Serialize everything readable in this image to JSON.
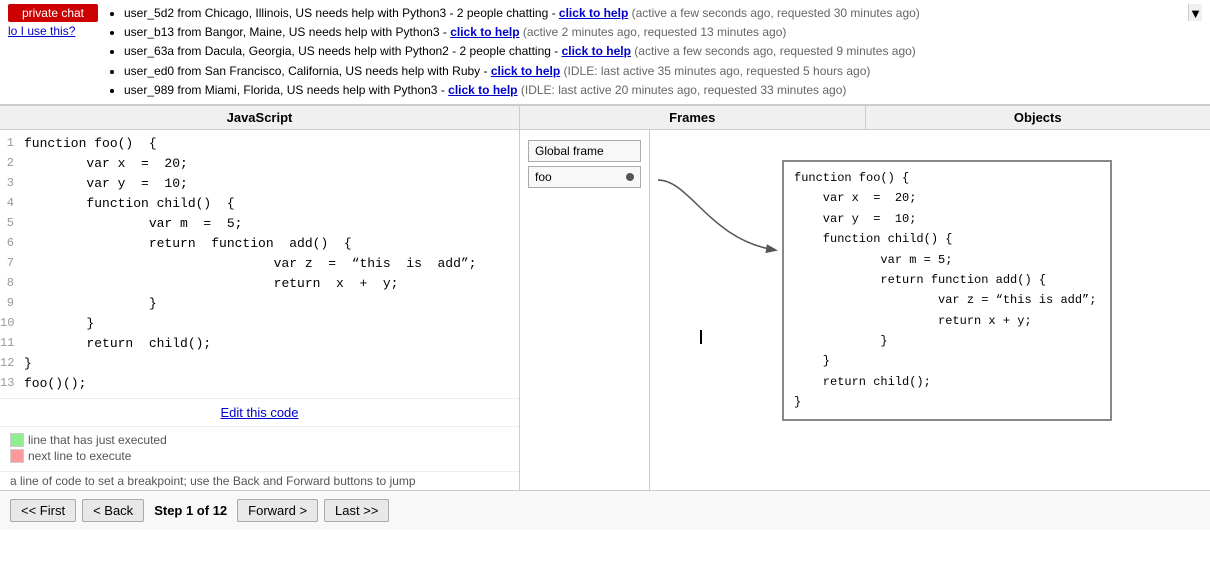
{
  "notifications": {
    "items": [
      {
        "text": "user_5d2 from Chicago, Illinois, US needs help with Python3 - 2 people chatting - ",
        "link": "click to help",
        "meta": "(active a few seconds ago, requested 30 minutes ago)"
      },
      {
        "text": "user_b13 from Bangor, Maine, US needs help with Python3 - ",
        "link": "click to help",
        "meta": "(active 2 minutes ago, requested 13 minutes ago)"
      },
      {
        "text": "user_63a from Dacula, Georgia, US needs help with Python2 - 2 people chatting - ",
        "link": "click to help",
        "meta": "(active a few seconds ago, requested 9 minutes ago)"
      },
      {
        "text": "user_ed0 from San Francisco, California, US needs help with Ruby - ",
        "link": "click to help",
        "meta": "(IDLE: last active 35 minutes ago, requested 5 hours ago)"
      },
      {
        "text": "user_989 from Miami, Florida, US needs help with Python3 - ",
        "link": "click to help",
        "meta": "(IDLE: last active 20 minutes ago, requested 33 minutes ago)"
      }
    ],
    "private_chat_label": "private chat",
    "how_link_label": "lo I use this?"
  },
  "panels": {
    "javascript_label": "JavaScript",
    "frames_label": "Frames",
    "objects_label": "Objects"
  },
  "code": {
    "lines": [
      {
        "num": "1",
        "content": "function foo()  {"
      },
      {
        "num": "2",
        "content": "        var x  =  20;"
      },
      {
        "num": "3",
        "content": "        var y  =  10;"
      },
      {
        "num": "4",
        "content": "        function child()  {"
      },
      {
        "num": "5",
        "content": "                var m  =  5;"
      },
      {
        "num": "6",
        "content": "                return  function  add()  {"
      },
      {
        "num": "7",
        "content": "                                var z  =  “this  is  add”;"
      },
      {
        "num": "8",
        "content": "                                return  x  +  y;"
      },
      {
        "num": "9",
        "content": "                }"
      },
      {
        "num": "10",
        "content": "        }"
      },
      {
        "num": "11",
        "content": "        return  child();"
      },
      {
        "num": "12",
        "content": "}"
      },
      {
        "num": "13",
        "content": "foo()();"
      }
    ],
    "edit_link": "Edit this code"
  },
  "legend": {
    "green_label": "line that has just executed",
    "red_label": "next line to execute",
    "click_hint": "a line of code to set a breakpoint; use the Back and Forward buttons to jump"
  },
  "frames": {
    "global_label": "Global frame",
    "foo_label": "foo"
  },
  "objects": {
    "display_text": "function foo() {\n    var x  =  20;\n    var y  =  10;\n    function child() {\n            var m = 5;\n            return function add() {\n                    var z = “this is add”;\n                    return x + y;\n            }\n    }\n    return child();\n}"
  },
  "navigation": {
    "first_label": "<< First",
    "back_label": "< Back",
    "step_text": "Step 1 of 12",
    "forward_label": "Forward >",
    "last_label": "Last >>"
  }
}
